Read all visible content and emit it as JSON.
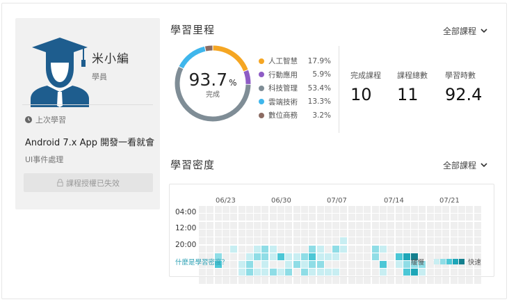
{
  "profile": {
    "name": "米小編",
    "role": "學員",
    "last_label": "上次學習",
    "course_title": "Android 7.x App 開發一看就會",
    "course_sub": "UI事件處理",
    "expired_label": "課程授權已失效"
  },
  "milestone": {
    "title": "學習里程",
    "filter": "全部課程",
    "percent": "93.7",
    "percent_unit": "%",
    "done_label": "完成",
    "categories": [
      {
        "name": "人工智慧",
        "value": "17.9%",
        "pct": 17.9,
        "color": "#f5a623"
      },
      {
        "name": "行動應用",
        "value": "5.9%",
        "pct": 5.9,
        "color": "#8e5cc5"
      },
      {
        "name": "科技管理",
        "value": "53.4%",
        "pct": 53.4,
        "color": "#7f8d96"
      },
      {
        "name": "雲端技術",
        "value": "13.3%",
        "pct": 13.3,
        "color": "#3fb6ec"
      },
      {
        "name": "數位商務",
        "value": "3.2%",
        "pct": 3.2,
        "color": "#8b6b62"
      }
    ],
    "stats": [
      {
        "label": "完成課程",
        "value": "10"
      },
      {
        "label": "課程總數",
        "value": "11"
      },
      {
        "label": "學習時數",
        "value": "92.4"
      }
    ]
  },
  "density": {
    "title": "學習密度",
    "filter": "全部課程",
    "weeks": [
      "06/23",
      "06/30",
      "07/07",
      "07/14",
      "07/21"
    ],
    "rows": [
      "04:00",
      "12:00",
      "20:00"
    ],
    "help": "什麼是學習密度？",
    "slow": "緩慢",
    "fast": "快速",
    "palette": [
      "#efefef",
      "#c8eef2",
      "#8fdde6",
      "#4cc7d6",
      "#1ea6b8",
      "#137f8e"
    ],
    "grid": [
      [
        0,
        0,
        0,
        0,
        0,
        0,
        0,
        0,
        0,
        0,
        0,
        0,
        0,
        0,
        0,
        0,
        0,
        0,
        0,
        0,
        0,
        0,
        0,
        0,
        0,
        0,
        0,
        0,
        0,
        0,
        0,
        0,
        0,
        0,
        0,
        0
      ],
      [
        0,
        0,
        0,
        0,
        0,
        0,
        0,
        0,
        0,
        0,
        0,
        0,
        0,
        0,
        0,
        0,
        0,
        0,
        0,
        0,
        0,
        0,
        0,
        0,
        0,
        0,
        0,
        0,
        0,
        0,
        0,
        0,
        0,
        0,
        0,
        0
      ],
      [
        0,
        0,
        0,
        0,
        0,
        0,
        0,
        0,
        0,
        0,
        0,
        0,
        0,
        0,
        0,
        0,
        0,
        0,
        0,
        0,
        0,
        0,
        0,
        0,
        0,
        0,
        0,
        0,
        0,
        0,
        0,
        0,
        0,
        0,
        0,
        0
      ],
      [
        0,
        0,
        0,
        0,
        0,
        0,
        0,
        0,
        0,
        0,
        0,
        0,
        0,
        0,
        0,
        0,
        0,
        0,
        0,
        0,
        0,
        0,
        0,
        0,
        0,
        0,
        0,
        0,
        0,
        0,
        0,
        0,
        0,
        0,
        0,
        0
      ],
      [
        0,
        0,
        0,
        0,
        0,
        0,
        0,
        0,
        0,
        0,
        0,
        0,
        0,
        0,
        0,
        0,
        0,
        0,
        1,
        0,
        0,
        0,
        0,
        0,
        0,
        0,
        0,
        0,
        0,
        0,
        0,
        0,
        0,
        0,
        0,
        0
      ],
      [
        0,
        0,
        0,
        0,
        1,
        0,
        0,
        1,
        2,
        1,
        0,
        0,
        0,
        0,
        2,
        1,
        0,
        2,
        1,
        0,
        0,
        0,
        2,
        1,
        0,
        0,
        0,
        0,
        0,
        0,
        0,
        0,
        0,
        0,
        0,
        0
      ],
      [
        0,
        0,
        2,
        0,
        0,
        0,
        1,
        2,
        2,
        1,
        3,
        1,
        1,
        2,
        3,
        1,
        1,
        1,
        0,
        0,
        0,
        0,
        2,
        0,
        0,
        3,
        4,
        5,
        0,
        0,
        0,
        0,
        0,
        0,
        0,
        0
      ],
      [
        0,
        0,
        3,
        0,
        0,
        1,
        2,
        0,
        1,
        0,
        0,
        1,
        2,
        1,
        2,
        2,
        0,
        0,
        0,
        0,
        0,
        0,
        0,
        3,
        0,
        1,
        2,
        2,
        2,
        0,
        0,
        0,
        0,
        0,
        0,
        0
      ],
      [
        0,
        0,
        0,
        0,
        0,
        1,
        2,
        1,
        1,
        2,
        1,
        2,
        0,
        2,
        1,
        1,
        1,
        1,
        0,
        0,
        0,
        0,
        0,
        1,
        0,
        0,
        3,
        4,
        1,
        0,
        0,
        0,
        0,
        0,
        0,
        0
      ],
      [
        0,
        0,
        0,
        0,
        0,
        0,
        0,
        0,
        0,
        0,
        0,
        0,
        0,
        0,
        0,
        0,
        0,
        0,
        0,
        0,
        0,
        0,
        0,
        0,
        0,
        0,
        0,
        0,
        0,
        0,
        0,
        0,
        0,
        0,
        0,
        0
      ]
    ]
  },
  "chart_data": {
    "type": "pie",
    "categories": [
      "人工智慧",
      "行動應用",
      "科技管理",
      "雲端技術",
      "數位商務"
    ],
    "values": [
      17.9,
      5.9,
      53.4,
      13.3,
      3.2
    ]
  }
}
